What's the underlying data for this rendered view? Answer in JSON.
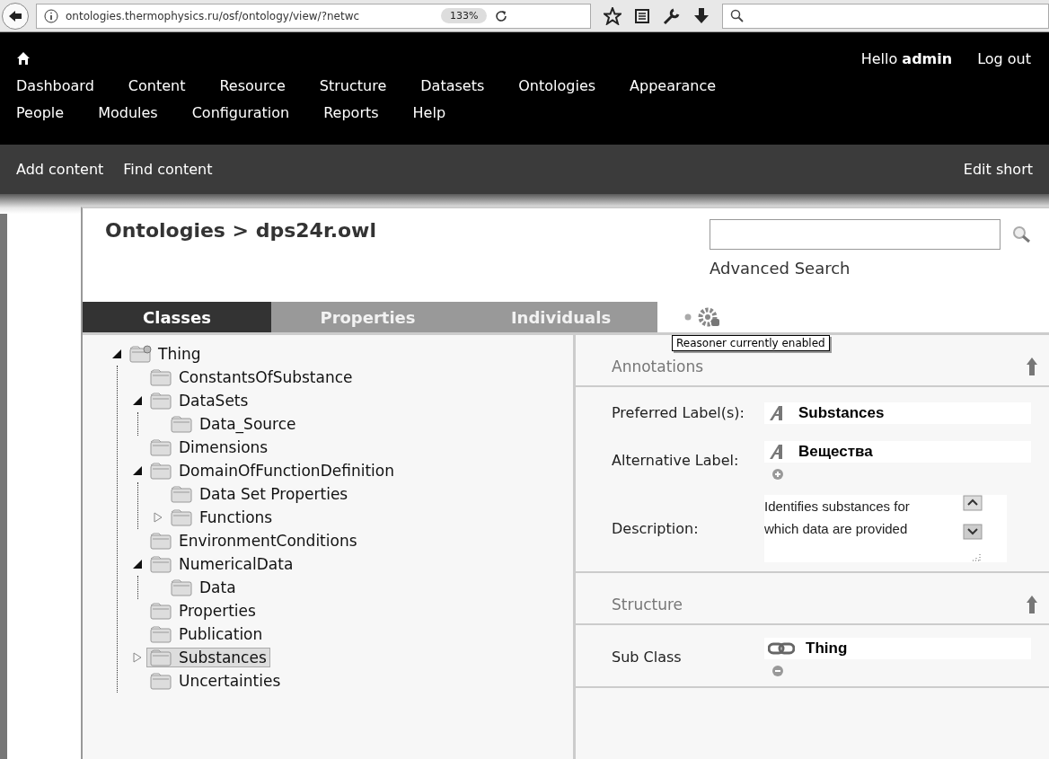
{
  "browser": {
    "url": "ontologies.thermophysics.ru/osf/ontology/view/?netwc",
    "zoom": "133%"
  },
  "header": {
    "greeting": "Hello **admin**",
    "logout": "Log out",
    "menu_rows": [
      [
        "Dashboard",
        "Content",
        "Resource",
        "Structure",
        "Datasets",
        "Ontologies",
        "Appearance"
      ],
      [
        "People",
        "Modules",
        "Configuration",
        "Reports",
        "Help"
      ]
    ]
  },
  "shortcuts": {
    "items": [
      "Add content",
      "Find content"
    ],
    "edit": "Edit short"
  },
  "page": {
    "title": "Ontologies > dps24r.owl",
    "advanced_search": "Advanced Search"
  },
  "tabs": [
    {
      "label": "Classes",
      "selected": true
    },
    {
      "label": "Properties",
      "selected": false
    },
    {
      "label": "Individuals",
      "selected": false
    }
  ],
  "reasoner": {
    "tooltip": "Reasoner currently enabled"
  },
  "tree": [
    {
      "label": "Thing",
      "kind": "root",
      "expanded": true,
      "selected": false,
      "children": [
        {
          "label": "ConstantsOfSubstance",
          "selected": false
        },
        {
          "label": "DataSets",
          "expanded": true,
          "selected": false,
          "children": [
            {
              "label": "Data_Source",
              "selected": false
            }
          ]
        },
        {
          "label": "Dimensions",
          "selected": false
        },
        {
          "label": "DomainOfFunctionDefinition",
          "expanded": true,
          "selected": false,
          "children": [
            {
              "label": "Data Set Properties",
              "selected": false
            },
            {
              "label": "Functions",
              "expanded": false,
              "selected": false
            }
          ]
        },
        {
          "label": "EnvironmentConditions",
          "selected": false
        },
        {
          "label": "NumericalData",
          "expanded": true,
          "selected": false,
          "children": [
            {
              "label": "Data",
              "selected": false
            }
          ]
        },
        {
          "label": "Properties",
          "selected": false
        },
        {
          "label": "Publication",
          "selected": false
        },
        {
          "label": "Substances",
          "expanded": false,
          "selected": true
        },
        {
          "label": "Uncertainties",
          "selected": false
        }
      ]
    }
  ],
  "sections": [
    {
      "title": "Annotations",
      "rows": [
        {
          "kind": "literal",
          "label": "Preferred Label(s):",
          "value": "Substances"
        },
        {
          "kind": "literal",
          "label": "Alternative Label:",
          "value": "Вещества",
          "can_add": true
        },
        {
          "kind": "text",
          "label": "Description:",
          "value": "Identifies substances for which data are provided"
        }
      ]
    },
    {
      "title": "Structure",
      "rows": [
        {
          "kind": "link",
          "label": "Sub Class",
          "value": "Thing",
          "can_remove": true
        }
      ]
    }
  ]
}
